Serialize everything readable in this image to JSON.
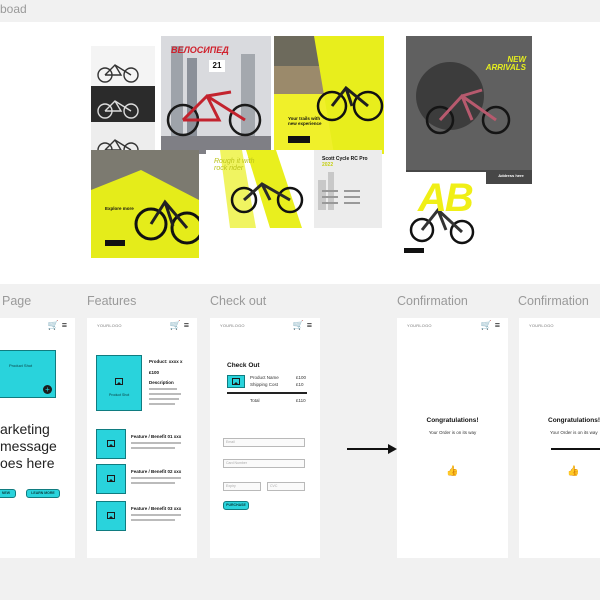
{
  "canvas": {
    "board_label": "boad"
  },
  "moodboard": {
    "posters": [
      {
        "label": "bike-lineup"
      },
      {
        "title": "ВЕЛОСИПЕД",
        "number": "21"
      },
      {
        "headline": "Your trails with new experience"
      },
      {
        "headline": "NEW ARRIVALS",
        "footer_items": [
          "Address here",
          "Address here",
          "Address here"
        ]
      },
      {
        "headline": "Explore more"
      },
      {
        "headline": "Rough it with rock rider"
      },
      {
        "headline": "Scott Cycle RC Pro",
        "accent": "2022"
      },
      {
        "headline": "AB"
      }
    ]
  },
  "flow": {
    "frames": [
      {
        "title": "Page"
      },
      {
        "title": "Features"
      },
      {
        "title": "Check out"
      },
      {
        "title": "Confirmation"
      },
      {
        "title": "Confirmation"
      }
    ],
    "logo_text": "YOURLOGO",
    "landing": {
      "hero_label": "Product Shot",
      "marketing_lines": [
        "arketing",
        "message",
        "oes here"
      ],
      "buttons": [
        "NEW",
        "LEARN MORE"
      ]
    },
    "features": {
      "product_label": "Product Shot",
      "product_name": "Product: xxxx x",
      "price": "£100",
      "description_title": "Description",
      "items": [
        {
          "title": "Feature / Benefit 01 xxx"
        },
        {
          "title": "Feature / Benefit 02 xxx"
        },
        {
          "title": "Feature / Benefit 03 xxx"
        }
      ]
    },
    "checkout": {
      "title": "Check Out",
      "rows": [
        {
          "label": "Product Name",
          "value": "£100"
        },
        {
          "label": "Shipping Cost",
          "value": "£10"
        }
      ],
      "total_label": "Total",
      "total_value": "£110",
      "fields": [
        "Email",
        "Card Number",
        "Expiry",
        "CVC"
      ],
      "button": "PURCHASE"
    },
    "confirmation": {
      "heading": "Congratulations!",
      "subtext": "Your Order is on its way"
    }
  },
  "colors": {
    "accent": "#29d3dc",
    "accent_border": "#107c80",
    "poster_yellow": "#e6ef1e"
  }
}
